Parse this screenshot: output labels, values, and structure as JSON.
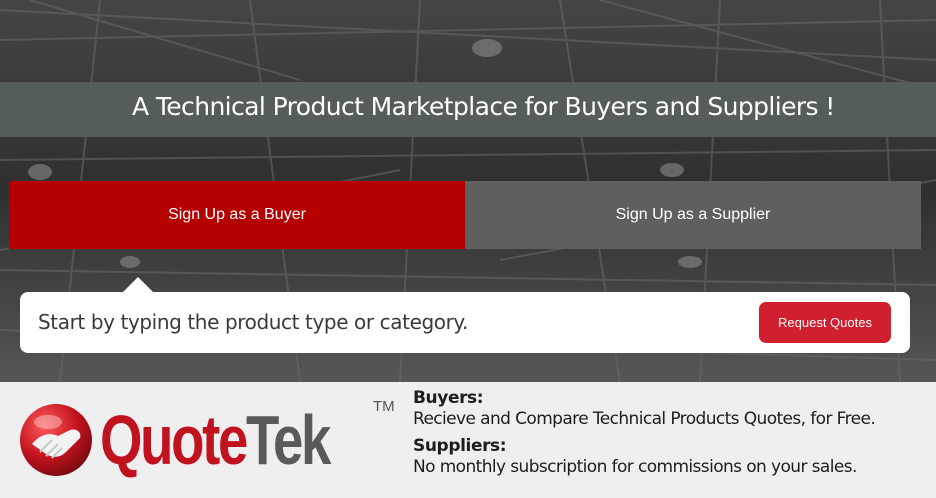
{
  "hero": {
    "title": "A Technical Product Marketplace for Buyers and Suppliers !"
  },
  "tabs": {
    "buyer_label": "Sign Up as a Buyer",
    "supplier_label": "Sign Up as a Supplier"
  },
  "search": {
    "placeholder": "Start by typing the product type or category.",
    "button_label": "Request Quotes"
  },
  "brand": {
    "name_part1": "Quote",
    "name_part2": "Tek",
    "trademark": "TM",
    "logo_icon": "handshake-icon"
  },
  "info": {
    "buyers_heading": "Buyers:",
    "buyers_text": "Recieve and Compare Technical Products Quotes, for Free.",
    "suppliers_heading": "Suppliers:",
    "suppliers_text": "No monthly subscription for commissions on your sales."
  },
  "colors": {
    "buyer_tab": "#b50000",
    "supplier_tab": "#5f5f5f",
    "request_button": "#d0202f",
    "brand_red": "#c1121f",
    "brand_gray": "#5a5a5a"
  }
}
